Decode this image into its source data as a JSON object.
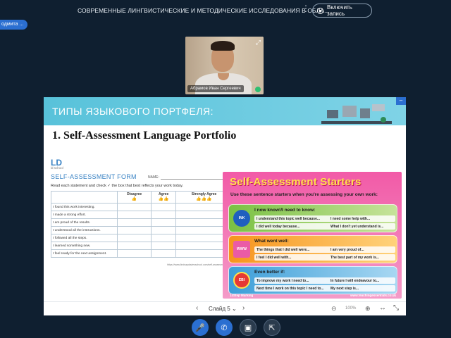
{
  "meeting": {
    "title": "СОВРЕМЕННЫЕ ЛИНГВИСТИЧЕСКИЕ И МЕТОДИЧЕСКИЕ ИССЛЕДОВАНИЯ В ОБЛА...",
    "more_label": "⋮",
    "record_label": "Включить запись",
    "moderator_label": "одмита ..."
  },
  "webcam": {
    "participant_name": "Абрамов Иван Сергеевич",
    "expand_label": "⤢"
  },
  "slide": {
    "header_title": "ТИПЫ ЯЗЫКОВОГО ПОРТФЕЛЯ:",
    "collapse_label": "–",
    "title": "1. Self-Assessment Language Portfolio",
    "form": {
      "logo_ld": "LD",
      "logo_sub": "ld school",
      "title": "SELF-ASSESSMENT FORM",
      "name_label": "NAME:",
      "instructions": "Read each statement and check ✓ the box that best reflects your work today.",
      "columns": [
        "Disagree",
        "Agree",
        "Strongly Agree"
      ],
      "column_icons": [
        "👍",
        "👍👍",
        "👍👍👍"
      ],
      "rows": [
        "I found this work interesting.",
        "I made a strong effort.",
        "I am proud of the results.",
        "I understood all the instructions.",
        "I followed all the steps.",
        "I learned something new.",
        "I feel ready for the next assignment."
      ],
      "url": "https://www.lindsaydaviesschool.com/self-assessment"
    },
    "starters": {
      "title": "Self-Assessment Starters",
      "subtitle": "Use these sentence starters when you're assessing your own work:",
      "boxes": [
        {
          "icon_label": "INK",
          "heading": "I now know!/I need to know:",
          "lines": [
            [
              "I understand this topic well because...",
              "I need some help with..."
            ],
            [
              "I did well today because...",
              "What I don't yet understand is..."
            ]
          ]
        },
        {
          "icon_label": "WWW",
          "heading": "What went well:",
          "lines": [
            [
              "The things that I did well were...",
              "I am very proud of..."
            ],
            [
              "I feel I did well with...",
              "The best part of my work is..."
            ]
          ]
        },
        {
          "icon_label": "EBI",
          "heading": "Even better if:",
          "lines": [
            [
              "To improve my work I need to...",
              "In future I will endeavour to..."
            ],
            [
              "Next time I work on this topic I need to...",
              "My next step is..."
            ]
          ]
        }
      ],
      "footer_left": "14Step Marking",
      "footer_right": "www.teachingessentials.co.uk"
    }
  },
  "presentation_bar": {
    "prev_label": "‹",
    "slide_label": "Слайд 5",
    "slide_caret": "⌄",
    "next_label": "›",
    "zoom_out_label": "⊖",
    "zoom_value": "100%",
    "zoom_in_label": "⊕",
    "fit_label": "↔",
    "fullscreen_label": "⤡"
  },
  "actions": {
    "mic_label": "🎤",
    "phone_label": "✆",
    "camera_label": "▣",
    "screen_label": "⇱"
  }
}
